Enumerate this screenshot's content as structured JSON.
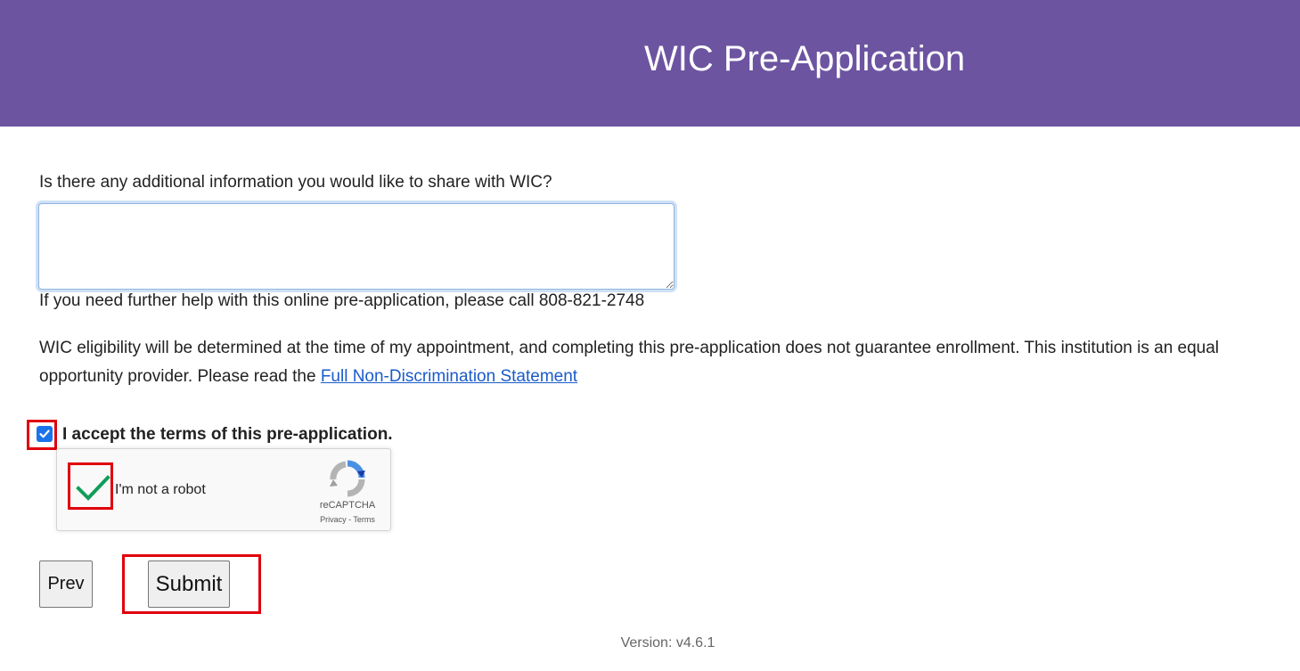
{
  "header": {
    "title": "WIC Pre-Application",
    "background_color": "#6c54a1"
  },
  "form": {
    "question_label": "Is there any additional information you would like to share with WIC?",
    "additional_info_value": "",
    "help_text": "If you need further help with this online pre-application, please call 808-821-2748",
    "eligibility_text": "WIC eligibility will be determined at the time of my appointment, and completing this pre-application does not guarantee enrollment. This institution is an equal opportunity provider. Please read the ",
    "non_discrimination_link": "Full Non-Discrimination Statement",
    "accept_label": "I accept the terms of this pre-application.",
    "accept_checked": true
  },
  "recaptcha": {
    "label": "I'm not a robot",
    "brand": "reCAPTCHA",
    "links": "Privacy - Terms",
    "verified": true,
    "check_color": "#109d58"
  },
  "buttons": {
    "prev_label": "Prev",
    "submit_label": "Submit"
  },
  "footer": {
    "version": "Version: v4.6.1"
  },
  "highlight_color": "#e0000a"
}
